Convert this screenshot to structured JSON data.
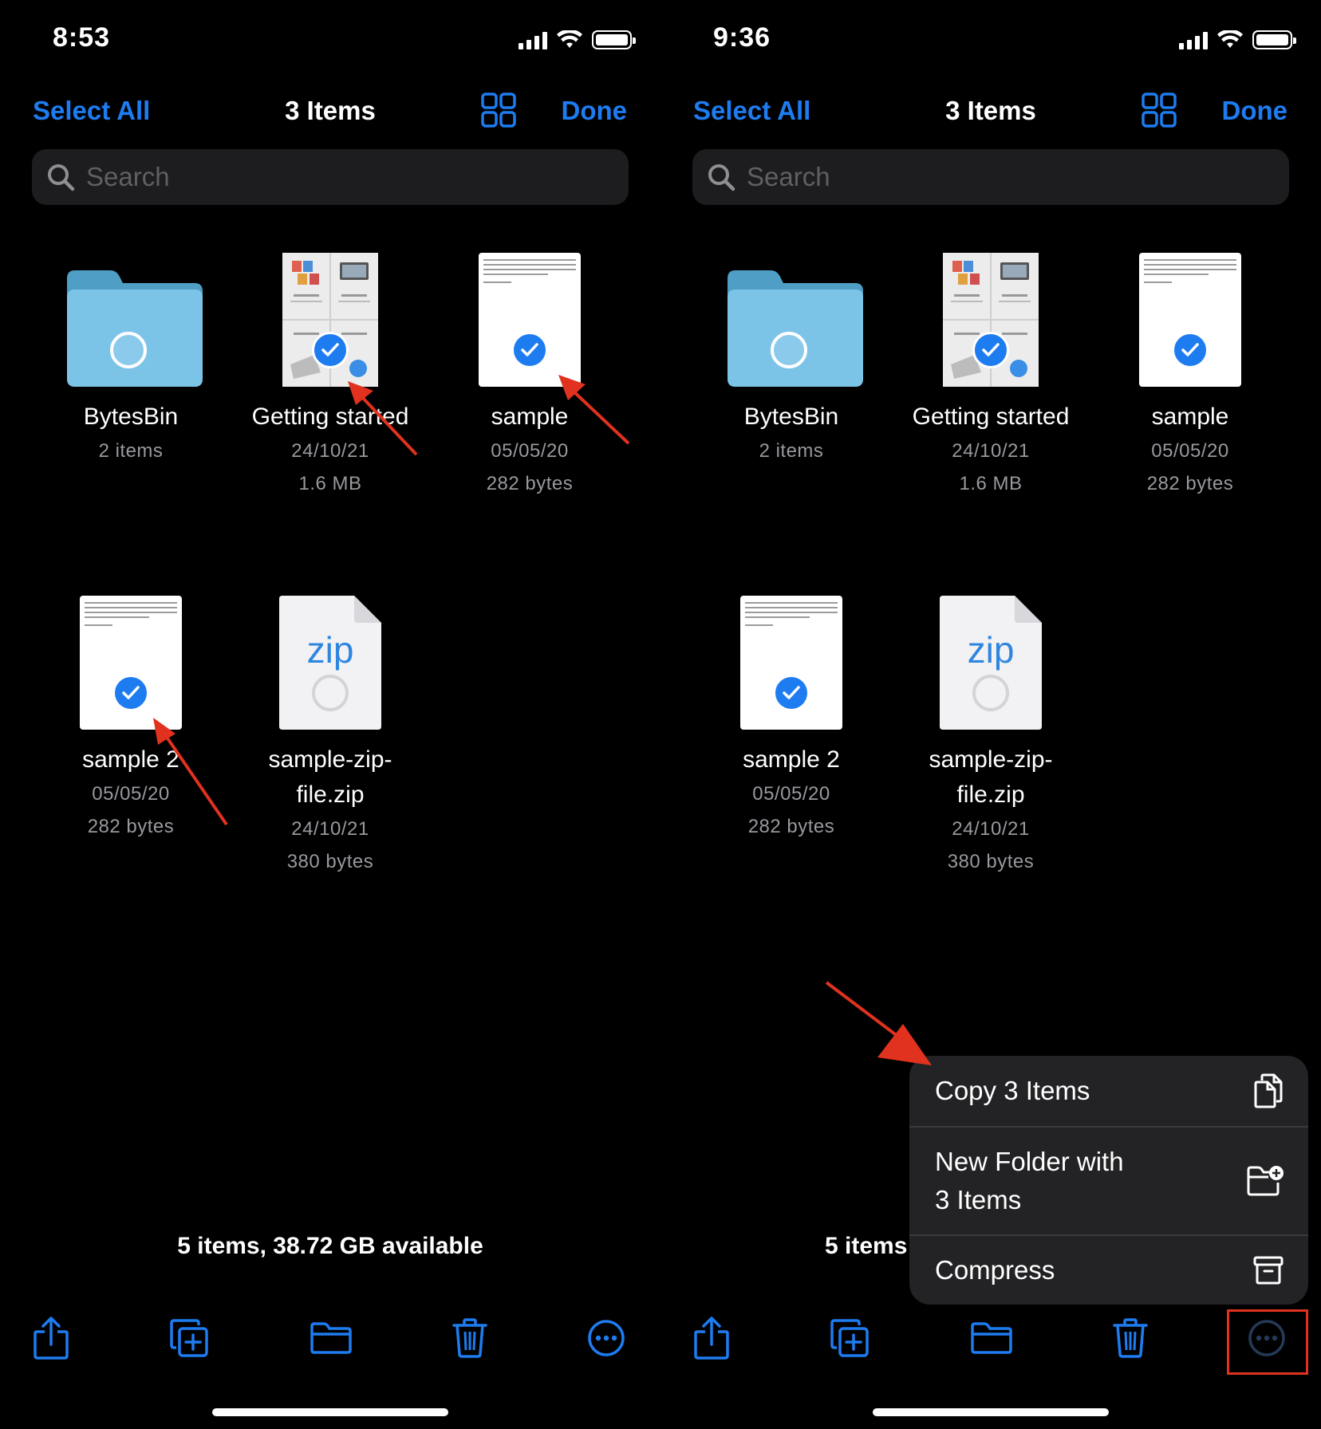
{
  "colors": {
    "accent": "#1e7cf1",
    "background": "#000000",
    "annotation": "#e0321e",
    "folder": "#7cc3e8"
  },
  "screens": [
    {
      "status": {
        "time": "8:53"
      },
      "nav": {
        "select_all": "Select All",
        "title": "3 Items",
        "done": "Done"
      },
      "search": {
        "placeholder": "Search"
      },
      "items": [
        {
          "name": "BytesBin",
          "meta": [
            "2 items"
          ],
          "kind": "folder",
          "selected": false
        },
        {
          "name": "Getting started",
          "meta": [
            "24/10/21",
            "1.6 MB"
          ],
          "kind": "brochure",
          "selected": true
        },
        {
          "name": "sample",
          "meta": [
            "05/05/20",
            "282 bytes"
          ],
          "kind": "text",
          "selected": true
        },
        {
          "name": "sample 2",
          "meta": [
            "05/05/20",
            "282 bytes"
          ],
          "kind": "text",
          "selected": true
        },
        {
          "name": "sample-zip-file.zip",
          "meta": [
            "24/10/21",
            "380 bytes"
          ],
          "kind": "zip",
          "selected": false,
          "thumb_text": "zip"
        }
      ],
      "footer": "5 items, 38.72 GB available",
      "toolbar": [
        "share-icon",
        "duplicate-icon",
        "folder-icon",
        "trash-icon",
        "more-icon"
      ]
    },
    {
      "status": {
        "time": "9:36"
      },
      "nav": {
        "select_all": "Select All",
        "title": "3 Items",
        "done": "Done"
      },
      "search": {
        "placeholder": "Search"
      },
      "items": [
        {
          "name": "BytesBin",
          "meta": [
            "2 items"
          ],
          "kind": "folder",
          "selected": false
        },
        {
          "name": "Getting started",
          "meta": [
            "24/10/21",
            "1.6 MB"
          ],
          "kind": "brochure",
          "selected": true
        },
        {
          "name": "sample",
          "meta": [
            "05/05/20",
            "282 bytes"
          ],
          "kind": "text",
          "selected": true
        },
        {
          "name": "sample 2",
          "meta": [
            "05/05/20",
            "282 bytes"
          ],
          "kind": "text",
          "selected": true
        },
        {
          "name": "sample-zip-file.zip",
          "meta": [
            "24/10/21",
            "380 bytes"
          ],
          "kind": "zip",
          "selected": false,
          "thumb_text": "zip"
        }
      ],
      "footer": "5 items",
      "toolbar": [
        "share-icon",
        "duplicate-icon",
        "folder-icon",
        "trash-icon",
        "more-icon"
      ],
      "menu": [
        {
          "label": "Copy 3 Items",
          "icon": "copy-icon"
        },
        {
          "label": "New Folder with\n3 Items",
          "icon": "folder-plus-icon"
        },
        {
          "label": "Compress",
          "icon": "archive-icon"
        }
      ]
    }
  ]
}
